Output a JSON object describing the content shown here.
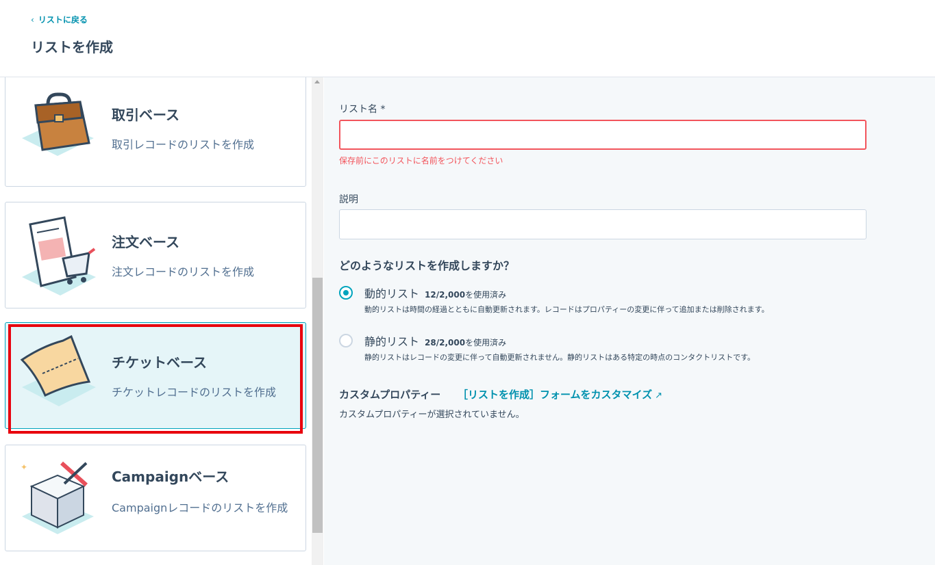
{
  "header": {
    "back_link": "リストに戻る",
    "title": "リストを作成"
  },
  "cards": [
    {
      "title": "取引ベース",
      "description": "取引レコードのリストを作成",
      "icon": "briefcase-illustration",
      "selected": false
    },
    {
      "title": "注文ベース",
      "description": "注文レコードのリストを作成",
      "icon": "order-cart-illustration",
      "selected": false
    },
    {
      "title": "チケットベース",
      "description": "チケットレコードのリストを作成",
      "icon": "ticket-illustration",
      "selected": true
    },
    {
      "title": "Campaignベース",
      "description": "Campaignレコードのリストを作成",
      "icon": "campaign-cube-illustration",
      "selected": false
    }
  ],
  "form": {
    "list_name_label": "リスト名",
    "required_mark": "*",
    "list_name_value": "",
    "list_name_error": "保存前にこのリストに名前をつけてください",
    "description_label": "説明",
    "description_value": "",
    "question": "どのようなリストを作成しますか？",
    "options": [
      {
        "label": "動的リスト",
        "usage_count": "12/2,000",
        "usage_suffix": "を使用済み",
        "description": "動的リストは時間の経過とともに自動更新されます。レコードはプロパティーの変更に伴って追加または削除されます。",
        "checked": true
      },
      {
        "label": "静的リスト",
        "usage_count": "28/2,000",
        "usage_suffix": "を使用済み",
        "description": "静的リストはレコードの変更に伴って自動更新されません。静的リストはある特定の時点のコンタクトリストです。",
        "checked": false
      }
    ],
    "custom_properties_title": "カスタムプロパティー",
    "custom_properties_link": "［リストを作成］フォームをカスタマイズ",
    "custom_properties_empty": "カスタムプロパティーが選択されていません。"
  },
  "colors": {
    "accent": "#00a4bd",
    "link": "#0091ae",
    "error": "#f2545b",
    "highlight": "#e8000d"
  }
}
